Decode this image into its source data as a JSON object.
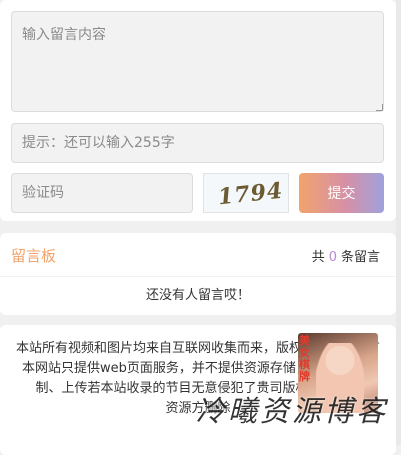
{
  "form": {
    "message_placeholder": "输入留言内容",
    "hint_placeholder": "提示：还可以输入255字",
    "captcha_placeholder": "验证码",
    "captcha_image_text": "1794",
    "submit_label": "提交"
  },
  "board": {
    "title": "留言板",
    "count_prefix": "共",
    "count": "0",
    "count_suffix": "条留言",
    "empty_message": "还没有人留言哎！"
  },
  "notice": {
    "line1": "本站所有视频和图片均来自互联网收集而来，版权归原创者所有",
    "line2": "本网站只提供web页面服务，并不提供资源存储，也不参与录制、上传若本站收录的节目无意侵犯了贵司版权，请联系",
    "line3": "资源方删除"
  },
  "promo": {
    "stamp_text": "美女棋牌"
  },
  "watermark": {
    "text": "冷曦资源博客"
  },
  "colors": {
    "accent_orange": "#f0a36c",
    "accent_purple": "#b68ad8",
    "field_bg": "#f2f2f2"
  }
}
